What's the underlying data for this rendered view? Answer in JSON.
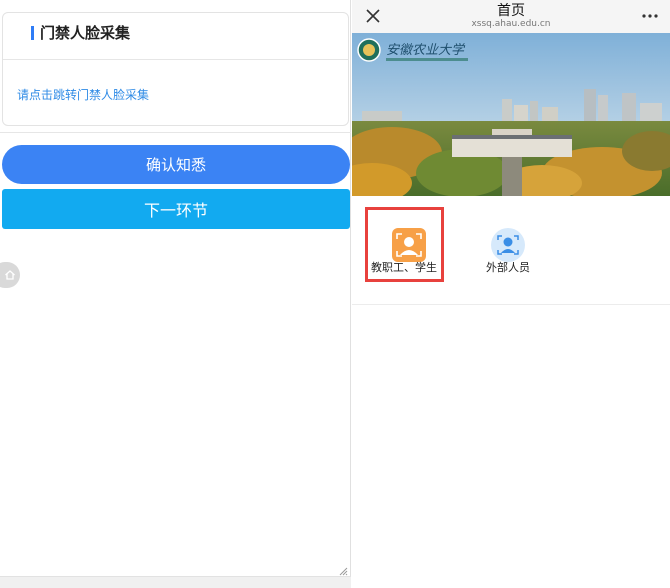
{
  "left": {
    "section_title": "门禁人脸采集",
    "link_text": "请点击跳转门禁人脸采集",
    "confirm_button": "确认知悉",
    "next_button": "下一环节"
  },
  "right": {
    "header": {
      "title": "首页",
      "url": "xssq.ahau.edu.cn"
    },
    "options": [
      {
        "label": "教职工、学生"
      },
      {
        "label": "外部人员"
      }
    ]
  },
  "colors": {
    "primary_blue": "#3b83f4",
    "next_blue": "#12aaf0",
    "link_blue": "#2f8be6",
    "accent": "#2f7cf6",
    "highlight_red": "#e8413d",
    "staff_icon_orange": "#f7a047"
  },
  "icons": {
    "close": "close-icon",
    "more": "more-icon",
    "home": "home-icon",
    "staff": "staff-face-icon",
    "visitor": "visitor-face-icon"
  }
}
